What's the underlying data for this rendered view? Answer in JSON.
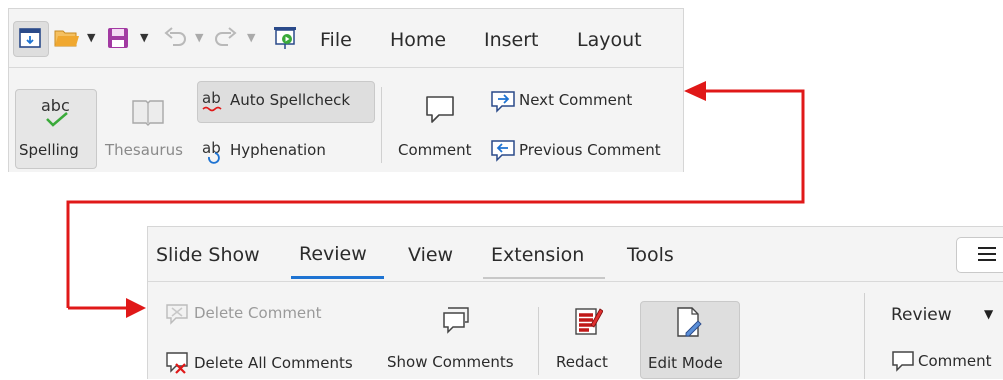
{
  "top": {
    "tabs": [
      "File",
      "Home",
      "Insert",
      "Layout"
    ],
    "buttons": {
      "spelling": "Spelling",
      "thesaurus": "Thesaurus",
      "auto_spellcheck": "Auto Spellcheck",
      "hyphenation": "Hyphenation",
      "comment": "Comment",
      "next_comment": "Next Comment",
      "previous_comment": "Previous Comment"
    },
    "icons": [
      "window-icon",
      "folder-open-icon",
      "save-icon",
      "undo-icon",
      "redo-icon",
      "slideshow-start-icon"
    ]
  },
  "bottom": {
    "tabs": [
      "Slide Show",
      "Review",
      "View",
      "Extension",
      "Tools"
    ],
    "active_tab": "Review",
    "buttons": {
      "delete_comment": "Delete Comment",
      "delete_all_comments": "Delete All Comments",
      "show_comments": "Show Comments",
      "redact": "Redact",
      "edit_mode": "Edit Mode",
      "review_menu": "Review",
      "comment": "Comment"
    },
    "menu_icon": "hamburger-menu-icon"
  },
  "colors": {
    "arrow": "#e01818",
    "active_tab_underline": "#1e73d2",
    "check_green": "#3aaa3a",
    "save_purple": "#a23aa2",
    "folder_orange": "#f0a830"
  }
}
